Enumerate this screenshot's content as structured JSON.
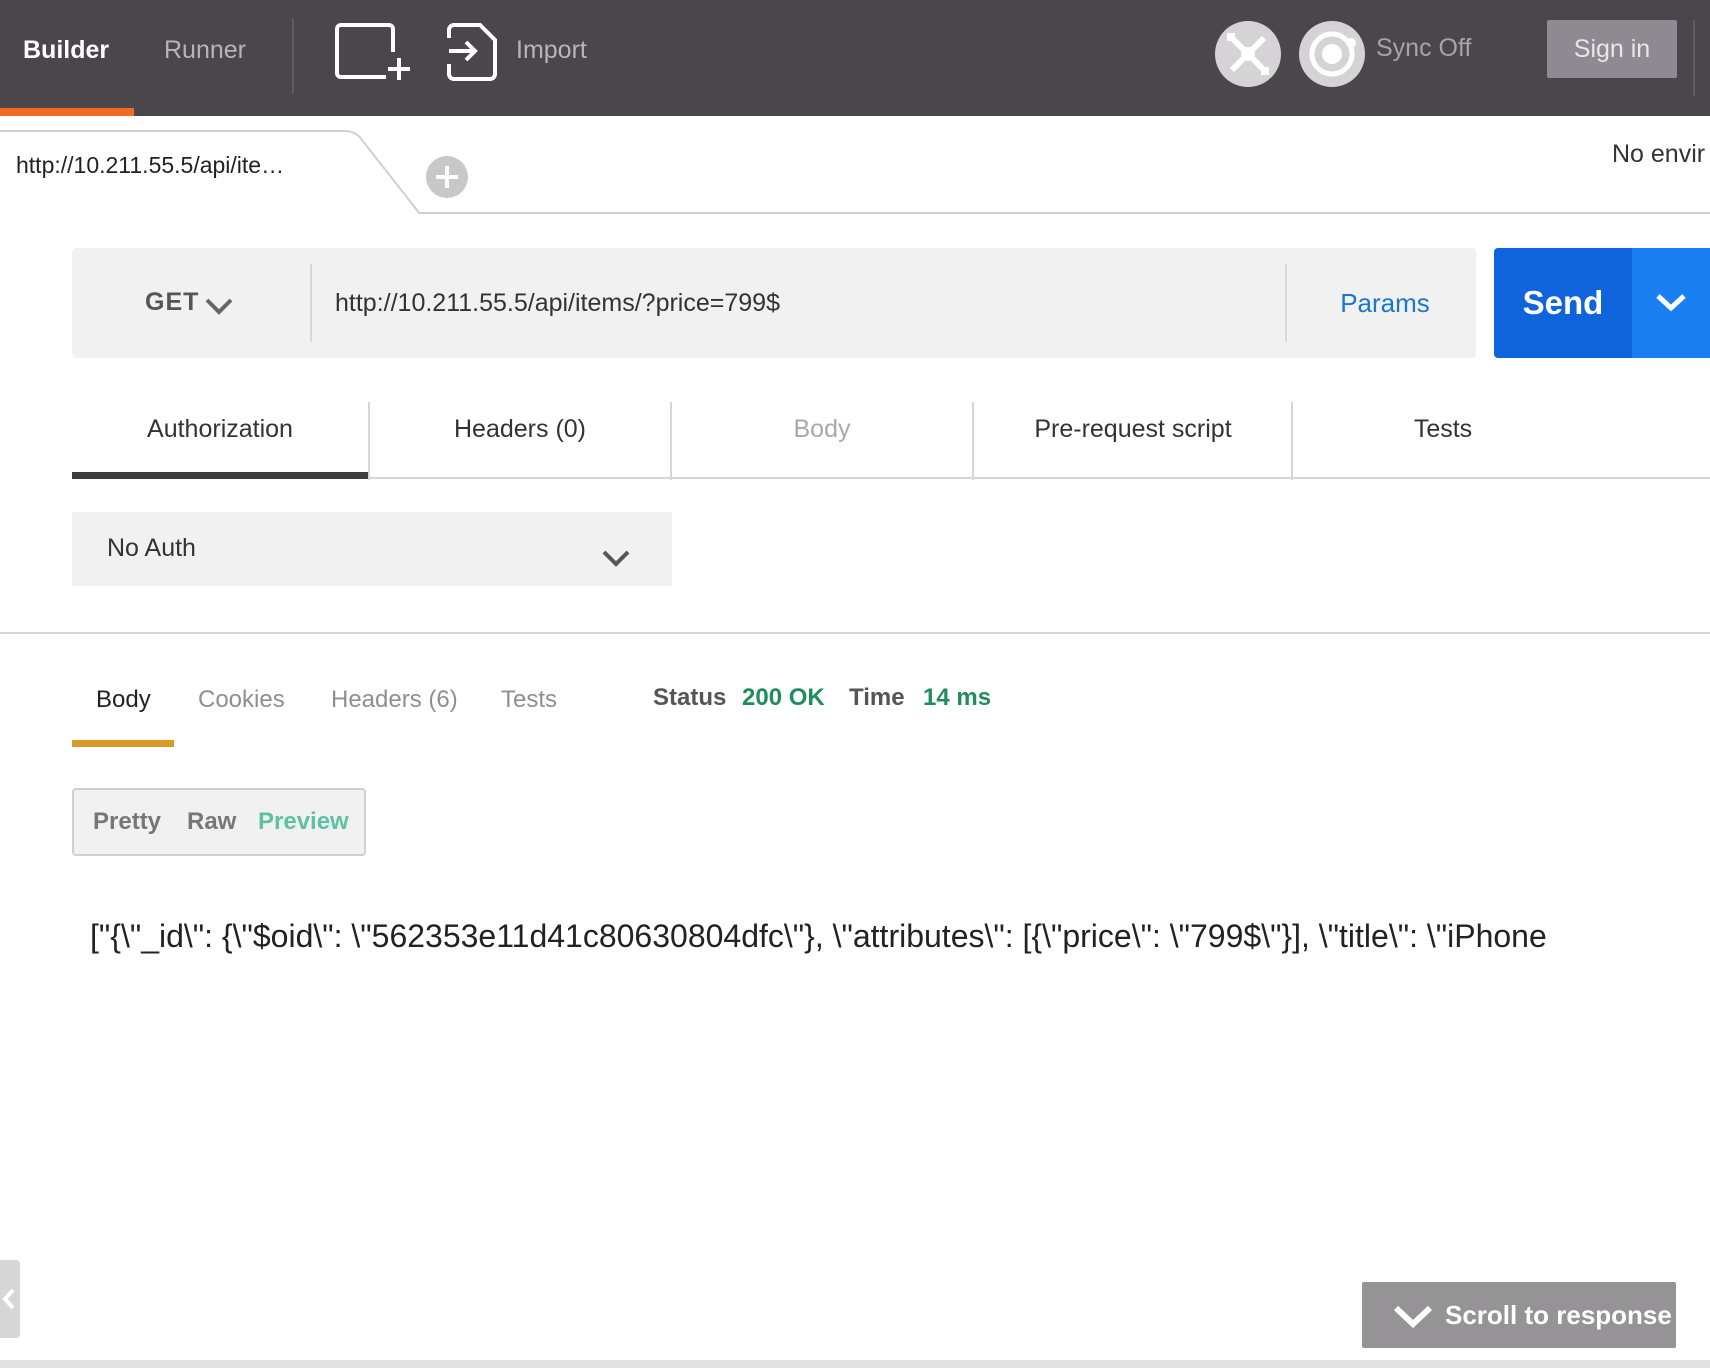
{
  "topbar": {
    "tabs": [
      {
        "label": "Builder",
        "active": true
      },
      {
        "label": "Runner",
        "active": false
      }
    ],
    "import_label": "Import",
    "sync_label": "Sync Off",
    "signin_label": "Sign in",
    "icons": [
      "new-window-icon",
      "import-icon",
      "interceptor-icon",
      "sync-icon"
    ],
    "accent_color": "#f26b22"
  },
  "request_tab": {
    "label": "http://10.211.55.5/api/ite…",
    "environment_label": "No envir"
  },
  "request": {
    "method": "GET",
    "url": "http://10.211.55.5/api/items/?price=799$",
    "params_label": "Params",
    "send_label": "Send"
  },
  "request_tabs": [
    {
      "label": "Authorization",
      "active": true
    },
    {
      "label": "Headers (0)"
    },
    {
      "label": "Body",
      "disabled": true
    },
    {
      "label": "Pre-request script"
    },
    {
      "label": "Tests"
    }
  ],
  "auth": {
    "selected": "No Auth"
  },
  "response": {
    "tabs": [
      {
        "label": "Body",
        "active": true
      },
      {
        "label": "Cookies"
      },
      {
        "label": "Headers (6)"
      },
      {
        "label": "Tests"
      }
    ],
    "status_label": "Status",
    "status_value": "200 OK",
    "time_label": "Time",
    "time_value": "14 ms",
    "view_modes": [
      {
        "label": "Pretty"
      },
      {
        "label": "Raw"
      },
      {
        "label": "Preview",
        "active": true
      }
    ],
    "body_text": "[\"{\\\"_id\\\": {\\\"$oid\\\": \\\"562353e11d41c80630804dfc\\\"}, \\\"attributes\\\": [{\\\"price\\\": \\\"799$\\\"}], \\\"title\\\": \\\"iPhone"
  },
  "scroll_button_label": "Scroll to response"
}
